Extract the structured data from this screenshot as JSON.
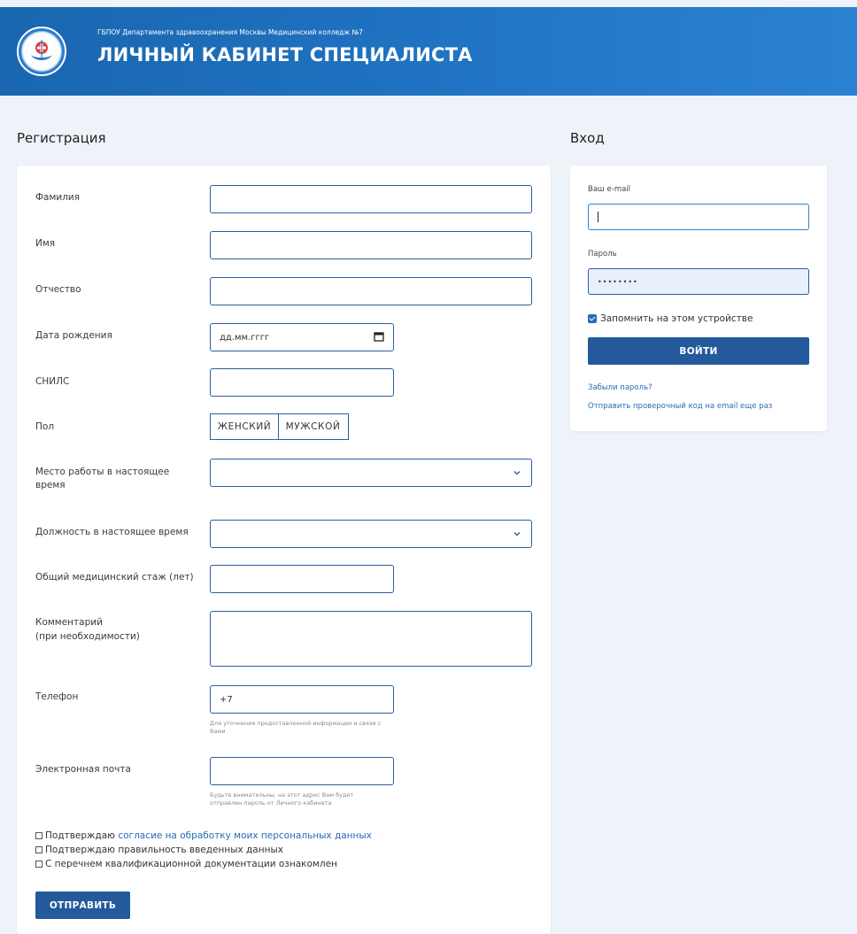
{
  "header": {
    "org_name": "ГБПОУ Департамента здравоохранения Москвы Медицинский колледж №7",
    "title": "ЛИЧНЫЙ КАБИНЕТ СПЕЦИАЛИСТА",
    "logo_icon": "medical-college-emblem-icon"
  },
  "registration": {
    "heading": "Регистрация",
    "fields": {
      "surname": "Фамилия",
      "name": "Имя",
      "patronymic": "Отчество",
      "birthdate": "Дата рождения",
      "birthdate_placeholder": "дд.мм.гггг",
      "snils": "СНИЛС",
      "gender": "Пол",
      "gender_female": "ЖЕНСКИЙ",
      "gender_male": "МУЖСКОЙ",
      "workplace": "Место работы в настоящее время",
      "position": "Должность в настоящее время",
      "experience": "Общий медицинский стаж (лет)",
      "comment_line1": "Комментарий",
      "comment_line2": "(при необходимости)",
      "phone": "Телефон",
      "phone_value": "+7",
      "phone_hint": "Для уточнения предоставленной информации и связи с Вами",
      "email": "Электронная почта",
      "email_hint": "Будьте внимательны, на этот адрес Вам будет отправлен пароль от Личного кабинета"
    },
    "checks": {
      "consent_prefix": "Подтверждаю",
      "consent_link": "согласие на обработку моих персональных данных",
      "confirm_data": "Подтверждаю правильность введенных данных",
      "docs_ack": "С перечнем квалификационной документации ознакомлен"
    },
    "submit_label": "ОТПРАВИТЬ"
  },
  "login": {
    "heading": "Вход",
    "email_label": "Ваш e-mail",
    "password_label": "Пароль",
    "password_value": "••••••••",
    "remember_label": "Запомнить на этом устройстве",
    "remember_checked": true,
    "submit_label": "ВОЙТИ",
    "forgot_link": "Забыли пароль?",
    "resend_link": "Отправить проверочный код на email еще раз"
  },
  "colors": {
    "header_bg": "#1f73c2",
    "button_bg": "#24599c",
    "input_border": "#2a5fa0",
    "link": "#2a6bb8",
    "page_bg": "#eef3fa"
  }
}
